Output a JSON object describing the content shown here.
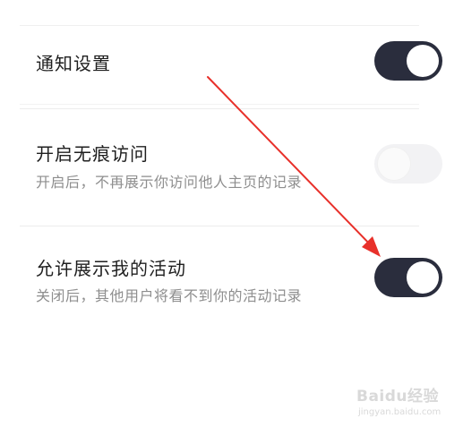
{
  "settings": {
    "notification": {
      "title": "通知设置",
      "enabled": true
    },
    "incognito_visit": {
      "title": "开启无痕访问",
      "subtitle": "开启后，不再展示你访问他人主页的记录",
      "enabled": false
    },
    "show_activity": {
      "title": "允许展示我的活动",
      "subtitle": "关闭后，其他用户将看不到你的活动记录",
      "enabled": true
    }
  },
  "annotation": {
    "arrow_color": "#e8302a"
  },
  "colors": {
    "toggle_on": "#2a2d3d",
    "toggle_off": "#f2f2f4"
  },
  "watermark": {
    "brand": "Baidu经验",
    "url": "jingyan.baidu.com"
  }
}
